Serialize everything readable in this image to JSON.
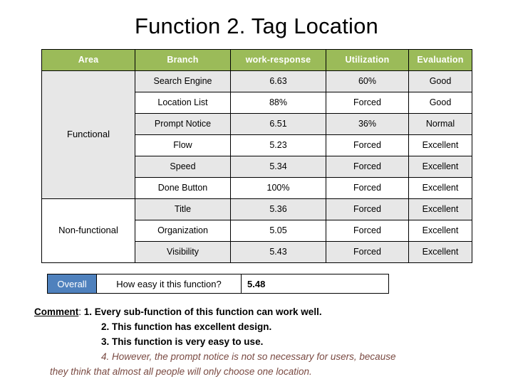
{
  "slide": {
    "title": "Function 2. Tag Location"
  },
  "table": {
    "headers": [
      "Area",
      "Branch",
      "work-response",
      "Utilization",
      "Evaluation"
    ],
    "areas": [
      {
        "label": "Functional",
        "rowspan": 6
      },
      {
        "label": "Non-functional",
        "rowspan": 3
      }
    ],
    "rows": [
      {
        "branch": "Search Engine",
        "work_response": "6.63",
        "utilization": "60%",
        "evaluation": "Good",
        "shaded": true
      },
      {
        "branch": "Location List",
        "work_response": "88%",
        "utilization": "Forced",
        "evaluation": "Good",
        "shaded": false
      },
      {
        "branch": "Prompt Notice",
        "work_response": "6.51",
        "utilization": "36%",
        "evaluation": "Normal",
        "shaded": true
      },
      {
        "branch": "Flow",
        "work_response": "5.23",
        "utilization": "Forced",
        "evaluation": "Excellent",
        "shaded": false
      },
      {
        "branch": "Speed",
        "work_response": "5.34",
        "utilization": "Forced",
        "evaluation": "Excellent",
        "shaded": true
      },
      {
        "branch": "Done Button",
        "work_response": "100%",
        "utilization": "Forced",
        "evaluation": "Excellent",
        "shaded": false
      },
      {
        "branch": "Title",
        "work_response": "5.36",
        "utilization": "Forced",
        "evaluation": "Excellent",
        "shaded": true
      },
      {
        "branch": "Organization",
        "work_response": "5.05",
        "utilization": "Forced",
        "evaluation": "Excellent",
        "shaded": false
      },
      {
        "branch": "Visibility",
        "work_response": "5.43",
        "utilization": "Forced",
        "evaluation": "Excellent",
        "shaded": true
      }
    ]
  },
  "overall": {
    "label": "Overall",
    "question": "How easy it this function?",
    "value": "5.48"
  },
  "comment": {
    "label": "Comment",
    "separator": ": ",
    "line1": "1. Every sub-function of this function can work well.",
    "line2": "2. This function has excellent design.",
    "line3": "3. This function is very easy to use.",
    "line4": "4. However, the prompt notice is not so necessary for users, because",
    "line5": "they think that almost all people will only choose one location."
  },
  "colors": {
    "header_green": "#9bbb59",
    "overall_blue": "#4f81bd",
    "row_shade": "#e7e7e7",
    "note_text": "#7a4a42"
  }
}
